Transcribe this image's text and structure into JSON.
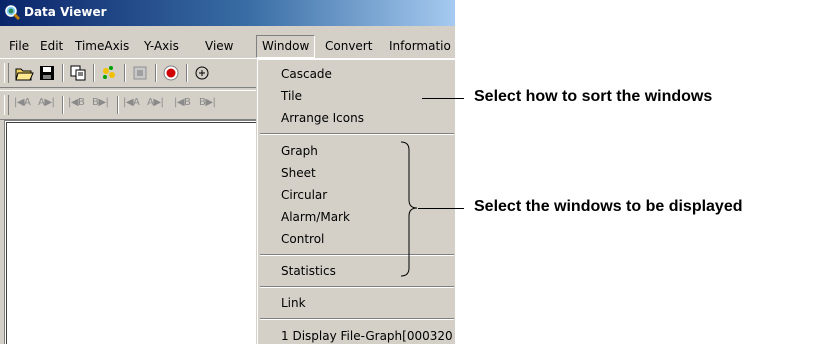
{
  "window": {
    "title": "Data Viewer"
  },
  "menubar": {
    "items": [
      "File",
      "Edit",
      "TimeAxis",
      "Y-Axis",
      "View",
      "Window",
      "Convert",
      "Informatio"
    ],
    "open_index": 5
  },
  "toolbar2": {
    "nav_labels": [
      "|◀A",
      "A▶|",
      "|◀B",
      "B▶|",
      "|◀A",
      "A▶|",
      "|◀B",
      "B▶|"
    ]
  },
  "window_menu": {
    "arrange_items": [
      "Cascade",
      "Tile",
      "Arrange Icons"
    ],
    "window_items": [
      "Graph",
      "Sheet",
      "Circular",
      "Alarm/Mark",
      "Control"
    ],
    "statistics_label": "Statistics",
    "link_label": "Link",
    "recent_file": "1 Display File-Graph[000320"
  },
  "annotations": {
    "sort_windows": "Select how to sort the windows",
    "display_windows": "Select the windows to be displayed"
  }
}
